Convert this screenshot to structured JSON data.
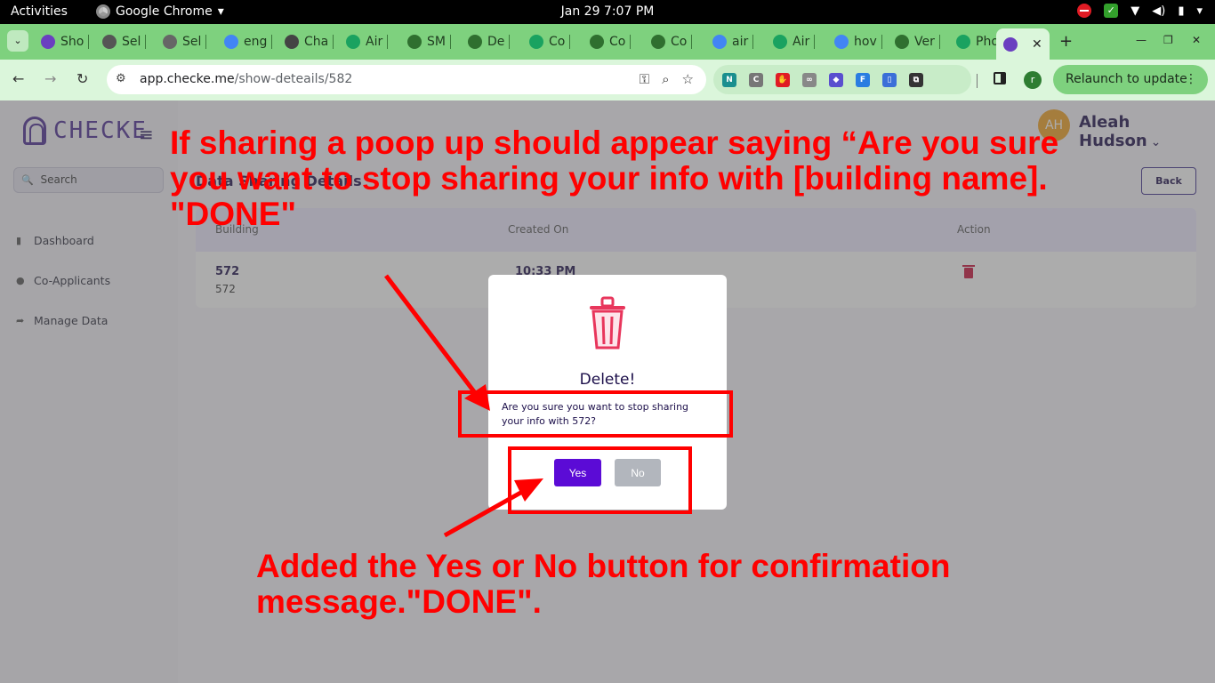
{
  "topbar": {
    "activities": "Activities",
    "app_name": "Google Chrome",
    "app_chevron": "▾",
    "clock": "Jan 29  7:07 PM",
    "tray_wifi": "▼",
    "tray_volume": "◀)",
    "tray_battery": "▮",
    "tray_menu": "▾"
  },
  "tabs": {
    "dropdown_glyph": "⌄",
    "items": [
      {
        "label": "Sho",
        "icon": "fingerprint-icon",
        "color": "#6a3fc0"
      },
      {
        "label": "Sel",
        "icon": "selenium-icon",
        "color": "#555555"
      },
      {
        "label": "Sel",
        "icon": "selenium-icon",
        "color": "#666666"
      },
      {
        "label": "eng",
        "icon": "google-icon",
        "color": "#4285f4"
      },
      {
        "label": "Cha",
        "icon": "openai-icon",
        "color": "#444444"
      },
      {
        "label": "Air",
        "icon": "air-icon",
        "color": "#1aa260"
      },
      {
        "label": "SM",
        "icon": "android-icon",
        "color": "#2f6f2f"
      },
      {
        "label": "De",
        "icon": "android-icon",
        "color": "#2f6f2f"
      },
      {
        "label": "Co",
        "icon": "air-icon",
        "color": "#1aa260"
      },
      {
        "label": "Co",
        "icon": "android-icon",
        "color": "#2f6f2f"
      },
      {
        "label": "Co",
        "icon": "android-icon",
        "color": "#2f6f2f"
      },
      {
        "label": "air",
        "icon": "google-icon",
        "color": "#4285f4"
      },
      {
        "label": "Air",
        "icon": "air-icon",
        "color": "#1aa260"
      },
      {
        "label": "hov",
        "icon": "google-icon",
        "color": "#4285f4"
      },
      {
        "label": "Ver",
        "icon": "android-icon",
        "color": "#2f6f2f"
      },
      {
        "label": "Pho",
        "icon": "air-icon",
        "color": "#1aa260"
      }
    ],
    "active_close": "✕",
    "new_tab": "+",
    "minimize": "—",
    "maximize": "❐",
    "close": "✕"
  },
  "toolbar": {
    "back": "←",
    "forward": "→",
    "reload": "↻",
    "tune_glyph": "⚙",
    "url_host": "app.checke.me",
    "url_path": "/show-deteails/582",
    "key_glyph": "⚿",
    "zoom_glyph": "⌕",
    "star_glyph": "☆",
    "extensions": [
      {
        "glyph": "N",
        "icon": "notion-extension-icon",
        "color": "#1a8f8f"
      },
      {
        "glyph": "C",
        "icon": "extension-c-icon",
        "color": "#777777"
      },
      {
        "glyph": "✋",
        "icon": "adblock-icon",
        "color": "#e01b24"
      },
      {
        "glyph": "∞",
        "icon": "extension-link-icon",
        "color": "#888888"
      },
      {
        "glyph": "◆",
        "icon": "extension-diamond-icon",
        "color": "#5a4fcf"
      },
      {
        "glyph": "F",
        "icon": "extension-f-icon",
        "color": "#2a7de1"
      },
      {
        "glyph": "▯",
        "icon": "clipboard-extension-icon",
        "color": "#3b6fd8"
      },
      {
        "glyph": "⧉",
        "icon": "puzzle-icon",
        "color": "#333333"
      }
    ],
    "profile_initial": "r",
    "relaunch": "Relaunch to update",
    "relaunch_more": "⋮"
  },
  "app": {
    "brand": "CHECKE",
    "hamburger": "≡",
    "search_placeholder": "Search",
    "search_glyph": "🔍",
    "sidebar": [
      {
        "label": "Dashboard",
        "glyph": "▮",
        "icon": "dashboard-icon"
      },
      {
        "label": "Co-Applicants",
        "glyph": "●",
        "icon": "user-icon"
      },
      {
        "label": "Manage Data",
        "glyph": "➦",
        "icon": "share-icon"
      }
    ],
    "user": {
      "initials": "AH",
      "name": "Aleah Hudson",
      "chevron": "⌄"
    },
    "page_title": "Data Sharing Details",
    "back_button": "Back",
    "table": {
      "headers": [
        "Building",
        "Created On",
        "Action"
      ],
      "row": {
        "building": "572",
        "building_sub": "572",
        "created_on": "10:33 PM"
      }
    }
  },
  "modal": {
    "title": "Delete!",
    "message": "Are you sure you want to stop sharing your info with 572?",
    "yes": "Yes",
    "no": "No",
    "trash_color": "#e8365c"
  },
  "annotations": {
    "top_text": "If sharing a poop up should appear saying “Are you sure you want to stop sharing your info with [building name]. \"DONE\"",
    "bottom_text": "Added the Yes or No button for confirmation message.\"DONE\".",
    "color": "#ff0000"
  }
}
